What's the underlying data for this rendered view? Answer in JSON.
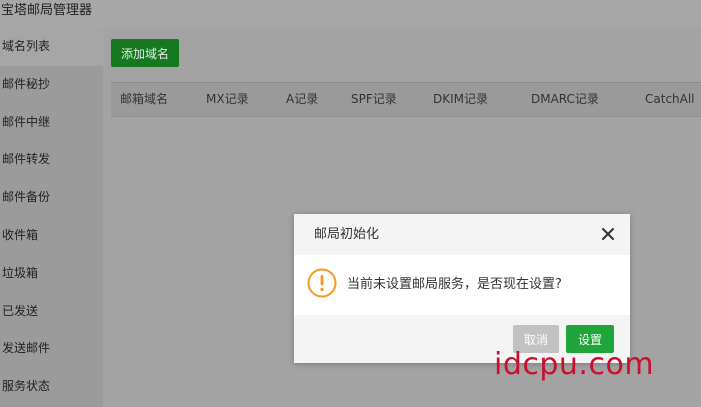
{
  "app": {
    "title": "宝塔邮局管理器"
  },
  "sidebar": {
    "items": [
      {
        "label": "域名列表",
        "active": true
      },
      {
        "label": "邮件秘抄"
      },
      {
        "label": "邮件中继"
      },
      {
        "label": "邮件转发"
      },
      {
        "label": "邮件备份"
      },
      {
        "label": "收件箱"
      },
      {
        "label": "垃圾箱"
      },
      {
        "label": "已发送"
      },
      {
        "label": "发送邮件"
      },
      {
        "label": "服务状态"
      }
    ]
  },
  "main": {
    "add_domain_label": "添加域名",
    "table": {
      "headers": [
        "邮箱域名",
        "MX记录",
        "A记录",
        "SPF记录",
        "DKIM记录",
        "DMARC记录",
        "CatchAll"
      ]
    }
  },
  "dialog": {
    "title": "邮局初始化",
    "icon": "warning-icon",
    "message": "当前未设置邮局服务，是否现在设置?",
    "cancel_label": "取消",
    "confirm_label": "设置"
  },
  "watermark": {
    "text": "idcpu.com"
  },
  "colors": {
    "accent_green": "#20a53a",
    "warning_orange": "#f39b1c",
    "watermark_red": "#c8102e"
  }
}
